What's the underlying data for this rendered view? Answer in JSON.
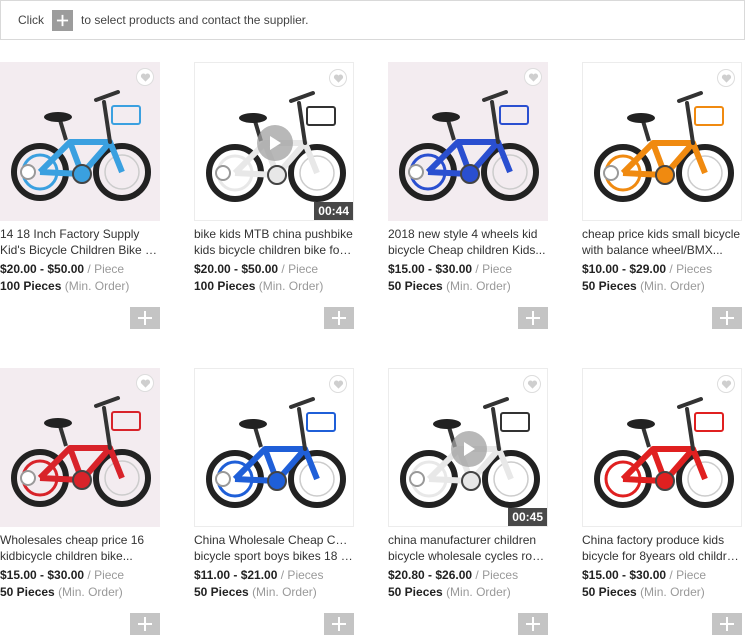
{
  "toolbar": {
    "text_before": "Click",
    "text_after": "to select products and contact the supplier."
  },
  "products": [
    {
      "title_line1": "14 18 Inch Factory Supply",
      "title_line2": "Kid's Bicycle Children Bike fo...",
      "price": "$20.00 - $50.00",
      "price_unit": "/ Piece",
      "moq": "100 Pieces",
      "moq_label": "(Min. Order)",
      "video": "",
      "bike_color": "#3aa0e0",
      "bg": "pink"
    },
    {
      "title_line1": "bike kids MTB china pushbike",
      "title_line2": "kids bicycle children bike for ...",
      "price": "$20.00 - $50.00",
      "price_unit": "/ Piece",
      "moq": "100 Pieces",
      "moq_label": "(Min. Order)",
      "video": "00:44",
      "bike_color": "#f2f2f2",
      "bg": "white"
    },
    {
      "title_line1": "2018 new style 4 wheels kid",
      "title_line2": "bicycle Cheap children Kids...",
      "price": "$15.00 - $30.00",
      "price_unit": "/ Piece",
      "moq": "50 Pieces",
      "moq_label": "(Min. Order)",
      "video": "",
      "bike_color": "#2a4fd0",
      "bg": "pink"
    },
    {
      "title_line1": "cheap price kids small bicycle",
      "title_line2": "with balance wheel/BMX...",
      "price": "$10.00 - $29.00",
      "price_unit": "/ Pieces",
      "moq": "50 Pieces",
      "moq_label": "(Min. Order)",
      "video": "",
      "bike_color": "#f08a10",
      "bg": "white"
    },
    {
      "title_line1": "Wholesales cheap price 16",
      "title_line2": "kidbicycle children bike...",
      "price": "$15.00 - $30.00",
      "price_unit": "/ Piece",
      "moq": "50 Pieces",
      "moq_label": "(Min. Order)",
      "video": "",
      "bike_color": "#d8232a",
      "bg": "pink"
    },
    {
      "title_line1": "China Wholesale Cheap Child",
      "title_line2": "bicycle sport boys bikes 18 1...",
      "price": "$11.00 - $21.00",
      "price_unit": "/ Pieces",
      "moq": "50 Pieces",
      "moq_label": "(Min. Order)",
      "video": "",
      "bike_color": "#1f5fd8",
      "bg": "white"
    },
    {
      "title_line1": "china manufacturer children",
      "title_line2": "bicycle wholesale cycles roa...",
      "price": "$20.80 - $26.00",
      "price_unit": "/ Pieces",
      "moq": "50 Pieces",
      "moq_label": "(Min. Order)",
      "video": "00:45",
      "bike_color": "#e6e6e6",
      "bg": "white"
    },
    {
      "title_line1": "China factory produce kids",
      "title_line2": "bicycle for 8years old childre...",
      "price": "$15.00 - $30.00",
      "price_unit": "/ Piece",
      "moq": "50 Pieces",
      "moq_label": "(Min. Order)",
      "video": "",
      "bike_color": "#e02020",
      "bg": "white"
    }
  ],
  "icons": {
    "heart": "heart-icon",
    "add": "plus-icon",
    "play": "play-icon"
  },
  "colors": {
    "plus_dark": "#9c9c9c",
    "plus_light": "#c4c4c4",
    "muted_text": "#999999"
  }
}
